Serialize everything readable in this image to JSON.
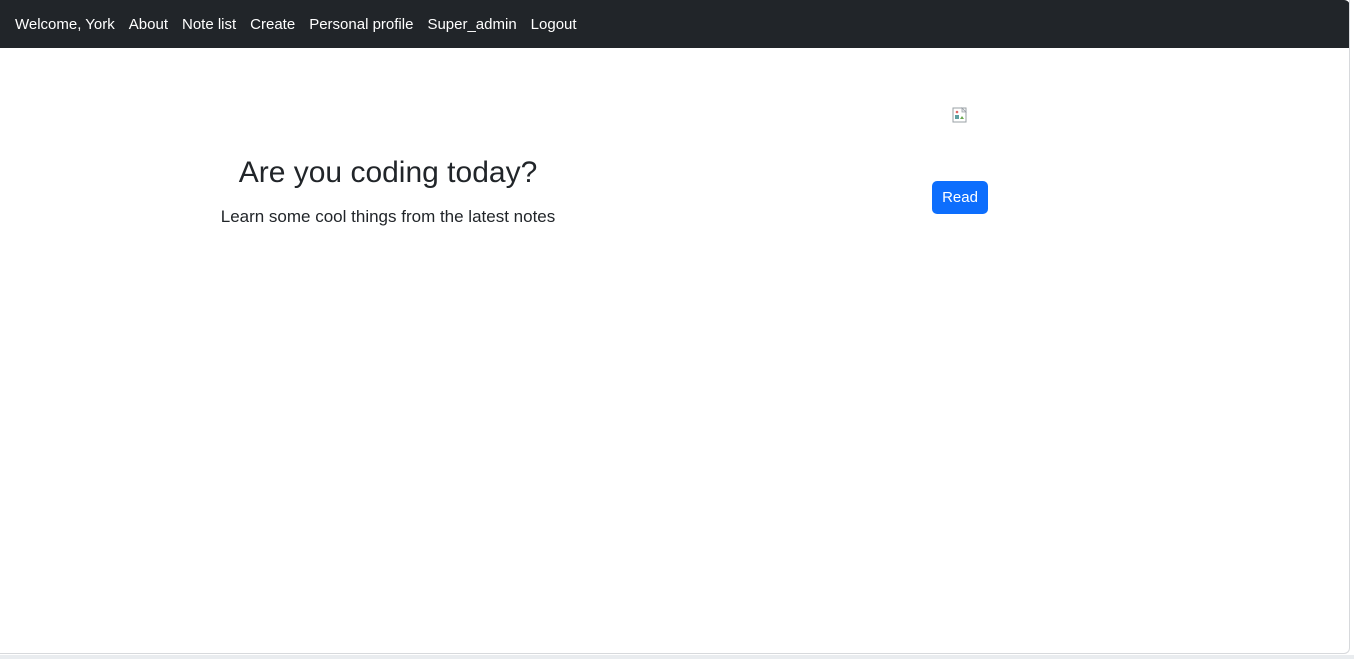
{
  "navbar": {
    "items": [
      {
        "label": "Welcome, York"
      },
      {
        "label": "About"
      },
      {
        "label": "Note list"
      },
      {
        "label": "Create"
      },
      {
        "label": "Personal profile"
      },
      {
        "label": "Super_admin"
      },
      {
        "label": "Logout"
      }
    ]
  },
  "hero": {
    "title": "Are you coding today?",
    "subtitle": "Learn some cool things from the latest notes"
  },
  "card": {
    "button_label": "Read"
  },
  "colors": {
    "navbar_bg": "#212529",
    "primary_button": "#0d6efd"
  }
}
